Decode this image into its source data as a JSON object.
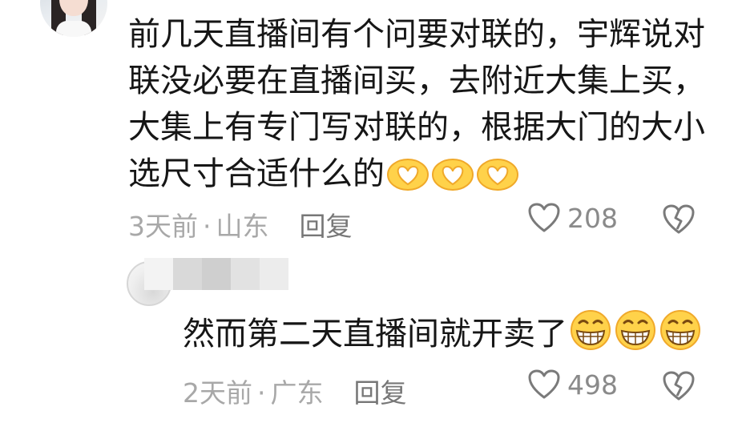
{
  "comment": {
    "text": "前几天直播间有个问要对联的，宇辉说对联没必要在直播间买，去附近大集上买，大集上有专门写对联的，根据大门的大小选尺寸合适什么的",
    "emojis": [
      "heart-hands-emoji",
      "heart-hands-emoji",
      "heart-hands-emoji"
    ],
    "time": "3天前",
    "separator": "·",
    "location": "山东",
    "reply_label": "回复",
    "likes": "208"
  },
  "reply": {
    "text": "然而第二天直播间就开卖了",
    "emojis": [
      "grinning-emoji",
      "grinning-emoji",
      "grinning-emoji"
    ],
    "time": "2天前",
    "separator": "·",
    "location": "广东",
    "reply_label": "回复",
    "likes": "498"
  },
  "colors": {
    "text": "#161616",
    "meta": "#a8a8a8",
    "emoji_yellow": "#ffd24a"
  }
}
